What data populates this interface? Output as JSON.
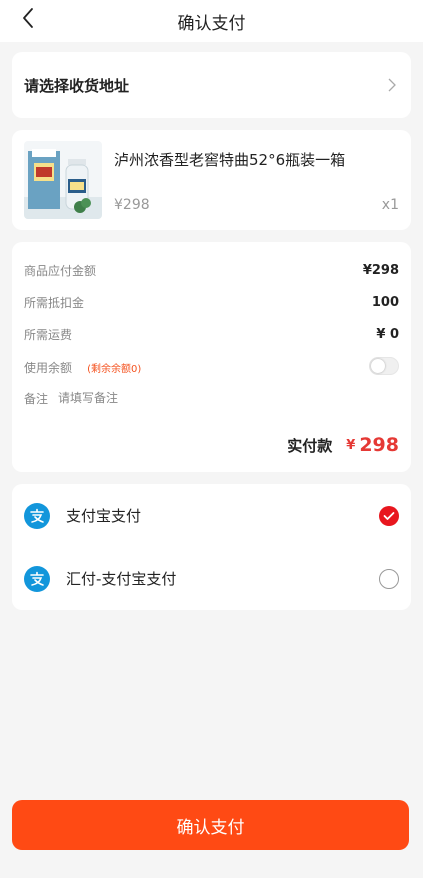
{
  "header": {
    "title": "确认支付",
    "back_icon": "back-arrow-icon"
  },
  "address": {
    "label": "请选择收货地址",
    "icon": "chevron-right-icon"
  },
  "product": {
    "name": "泸州浓香型老窖特曲52°6瓶装一箱",
    "price": "¥298",
    "qty": "x1"
  },
  "summary": {
    "rows": [
      {
        "label": "商品应付金额",
        "value": "¥298"
      },
      {
        "label": "所需抵扣金",
        "value": "100"
      },
      {
        "label": "所需运费",
        "value": "¥ 0"
      }
    ],
    "balance_label": "使用余额",
    "balance_remaining": "(剩余余额0)",
    "remark_label": "备注",
    "remark_placeholder": "请填写备注",
    "total_label": "实付款",
    "total_currency": "¥",
    "total_value": "298"
  },
  "payment": {
    "methods": [
      {
        "name": "支付宝支付",
        "selected": true,
        "icon": "alipay-icon"
      },
      {
        "name": "汇付-支付宝支付",
        "selected": false,
        "icon": "alipay-icon"
      }
    ]
  },
  "confirm_button": "确认支付",
  "colors": {
    "accent": "#ff4a14",
    "price_red": "#e53935",
    "alipay_blue": "#1296db",
    "check_red": "#e8161e"
  }
}
